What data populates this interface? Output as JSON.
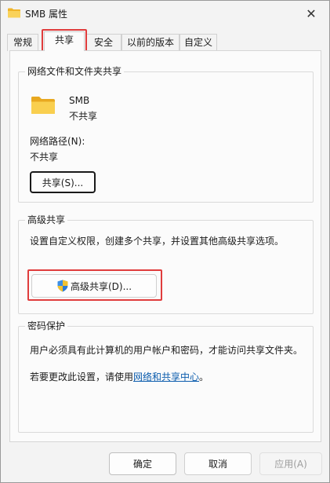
{
  "window": {
    "title": "SMB 属性",
    "close_icon": "close-icon"
  },
  "tabs": [
    {
      "label": "常规"
    },
    {
      "label": "共享"
    },
    {
      "label": "安全"
    },
    {
      "label": "以前的版本"
    },
    {
      "label": "自定义"
    }
  ],
  "network_sharing": {
    "group_title": "网络文件和文件夹共享",
    "folder_name": "SMB",
    "share_status": "不共享",
    "path_label": "网络路径(N):",
    "path_value": "不共享",
    "share_button": "共享(S)..."
  },
  "advanced_sharing": {
    "group_title": "高级共享",
    "description": "设置自定义权限，创建多个共享，并设置其他高级共享选项。",
    "button_label": "高级共享(D)...",
    "button_icon": "uac-shield-icon"
  },
  "password_protection": {
    "group_title": "密码保护",
    "description": "用户必须具有此计算机的用户帐户和密码，才能访问共享文件夹。",
    "change_prefix": "若要更改此设置，请使用",
    "change_link": "网络和共享中心",
    "change_suffix": "。"
  },
  "footer": {
    "ok": "确定",
    "cancel": "取消",
    "apply": "应用(A)"
  },
  "colors": {
    "highlight_red": "#e03c3c",
    "link_blue": "#0b5cad",
    "folder_yellow": "#f6c644"
  }
}
